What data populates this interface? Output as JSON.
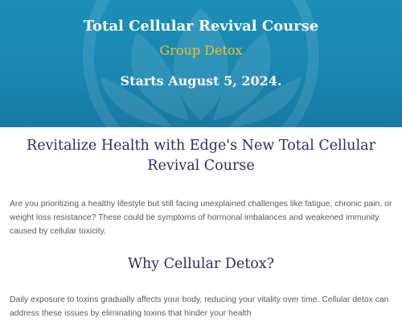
{
  "hero": {
    "title": "Total Cellular Revival Course",
    "subtitle": "Group Detox",
    "date": "Starts August 5, 2024.",
    "background_color": "#1a87b2",
    "subtitle_color": "#f2c21b",
    "title_color": "#ffffff"
  },
  "intro": {
    "heading": "Revitalize Health with Edge's New Total Cellular Revival Course",
    "paragraph": "Are you prioritizing a healthy lifestyle but still facing unexplained challenges like fatigue, chronic pain, or weight loss resistance? These could be symptoms of hormonal imbalances and weakened immunity caused by cellular toxicity."
  },
  "why": {
    "heading": "Why Cellular Detox?",
    "paragraph": "Daily exposure to toxins gradually affects your body, reducing your vitality over time. Cellular detox can address these issues by eliminating toxins that hinder your health"
  },
  "colors": {
    "heading": "#2b2d6e",
    "body_text": "#5a5a5a"
  }
}
